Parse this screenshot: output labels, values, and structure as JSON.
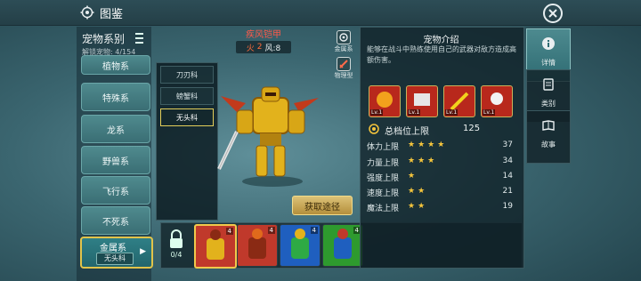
{
  "header": {
    "title": "图鉴",
    "icon": "settings-gear-icon",
    "close_icon": "close-icon"
  },
  "left_panel": {
    "title": "宠物系别",
    "unlock_text": "解锁宠物: 4/154",
    "categories": [
      "植物系",
      "特殊系",
      "龙系",
      "野兽系",
      "飞行系",
      "不死系"
    ],
    "active_category": "金属系",
    "active_subcategory": "无头科"
  },
  "sub_list": {
    "items": [
      "刀刃科",
      "螃蟹科",
      "无头科"
    ],
    "selected": "无头科"
  },
  "pet": {
    "name": "疾风铠甲",
    "element": "火",
    "element_value": "2",
    "wind_label": "风:8"
  },
  "type_badges": [
    {
      "label": "金属系",
      "icon": "metal-type-icon"
    },
    {
      "label": "物理型",
      "icon": "physical-type-icon"
    }
  ],
  "get_button": "获取途径",
  "bottom": {
    "lock_count": "0/4",
    "lock_icon": "lock-icon",
    "slots": [
      {
        "level": "4",
        "color": "#c0392b"
      },
      {
        "level": "4",
        "color": "#c0392b"
      },
      {
        "level": "4",
        "color": "#1f5fbf"
      },
      {
        "level": "4",
        "color": "#2e9a2e"
      }
    ]
  },
  "info": {
    "title": "宠物介绍",
    "description": "能够在战斗中熟练使用自己的武器对敌方造成高额伤害。",
    "skills": [
      {
        "level": "Lv.1"
      },
      {
        "level": "Lv.1"
      },
      {
        "level": "Lv.1"
      },
      {
        "level": "Lv.1"
      }
    ],
    "total_label": "总档位上限",
    "total_value": "125",
    "stats": [
      {
        "name": "体力上限",
        "stars": "★★★★",
        "value": "37"
      },
      {
        "name": "力量上限",
        "stars": "★★★",
        "value": "34"
      },
      {
        "name": "强度上限",
        "stars": "★",
        "value": "14"
      },
      {
        "name": "速度上限",
        "stars": "★★",
        "value": "21"
      },
      {
        "name": "魔法上限",
        "stars": "★★",
        "value": "19"
      }
    ]
  },
  "tabs": [
    {
      "label": "详情",
      "icon": "info-icon"
    },
    {
      "label": "类别",
      "icon": "category-card-icon"
    },
    {
      "label": "故事",
      "icon": "story-book-icon"
    }
  ]
}
